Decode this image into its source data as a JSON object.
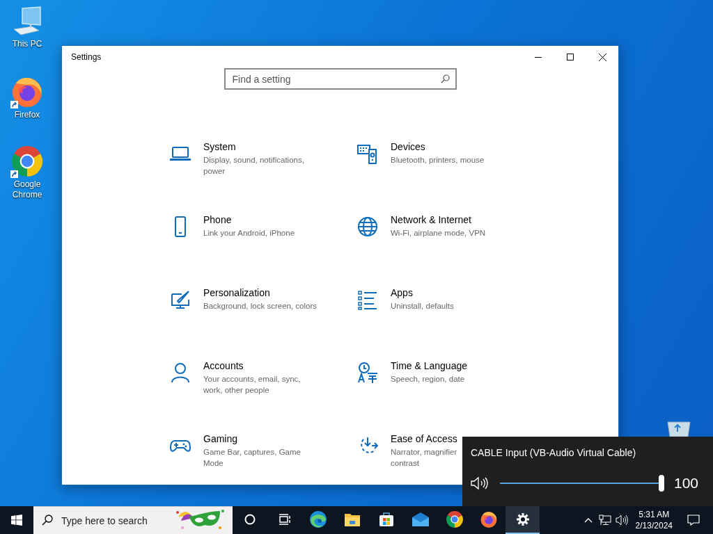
{
  "desktop_icons": [
    {
      "label": "This PC",
      "kind": "computer",
      "shortcut": false
    },
    {
      "label": "Firefox",
      "kind": "firefox",
      "shortcut": true
    },
    {
      "label": "Google Chrome",
      "kind": "chrome",
      "shortcut": true
    }
  ],
  "window": {
    "title": "Settings",
    "search": {
      "placeholder": "Find a setting"
    },
    "categories": [
      {
        "kind": "laptop",
        "title": "System",
        "description": [
          "Display, sound, notifications,",
          "power"
        ]
      },
      {
        "kind": "devices",
        "title": "Devices",
        "description": [
          "Bluetooth, printers, mouse"
        ]
      },
      {
        "kind": "phone",
        "title": "Phone",
        "description": [
          "Link your Android, iPhone"
        ]
      },
      {
        "kind": "globe",
        "title": "Network & Internet",
        "description": [
          "Wi-Fi, airplane mode, VPN"
        ]
      },
      {
        "kind": "brush",
        "title": "Personalization",
        "description": [
          "Background, lock screen, colors"
        ]
      },
      {
        "kind": "apps",
        "title": "Apps",
        "description": [
          "Uninstall, defaults"
        ]
      },
      {
        "kind": "person",
        "title": "Accounts",
        "description": [
          "Your accounts, email, sync,",
          "work, other people"
        ]
      },
      {
        "kind": "time",
        "title": "Time & Language",
        "description": [
          "Speech, region, date"
        ]
      },
      {
        "kind": "gamepad",
        "title": "Gaming",
        "description": [
          "Game Bar, captures, Game",
          "Mode"
        ]
      },
      {
        "kind": "ease",
        "title": "Ease of Access",
        "description": [
          "Narrator, magnifier",
          "contrast"
        ]
      }
    ]
  },
  "volume_flyout": {
    "device": "CABLE Input (VB-Audio Virtual Cable)",
    "level": 1,
    "reading": "100"
  },
  "taskbar": {
    "search": {
      "placeholder": "Type here to search"
    },
    "apps": [
      {
        "kind": "cortana",
        "active": false
      },
      {
        "kind": "taskview",
        "active": false
      },
      {
        "kind": "edge",
        "active": false
      },
      {
        "kind": "explorer",
        "active": false
      },
      {
        "kind": "store",
        "active": false
      },
      {
        "kind": "mail",
        "active": false
      },
      {
        "kind": "chrome",
        "active": false
      },
      {
        "kind": "firefox",
        "active": false
      },
      {
        "kind": "settings",
        "active": true
      }
    ],
    "clock": {
      "time": "5:31 AM",
      "date": "2/13/2024"
    }
  }
}
